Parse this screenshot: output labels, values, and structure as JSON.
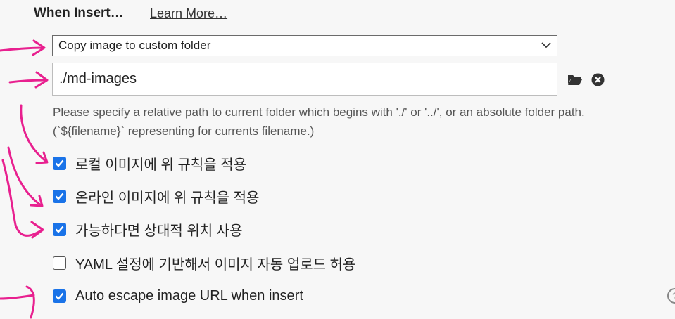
{
  "section": {
    "title": "When Insert…",
    "learn_more": "Learn More…"
  },
  "image_action_select": {
    "value": "Copy image to custom folder"
  },
  "path_input": {
    "value": "./md-images"
  },
  "hint": "Please specify a relative path to current folder which begins with './' or '../', or an absolute folder path. (`${filename}` representing for currents filename.)",
  "options": [
    {
      "label": "로컬 이미지에 위 규칙을 적용",
      "checked": true
    },
    {
      "label": "온라인 이미지에 위 규칙을 적용",
      "checked": true
    },
    {
      "label": "가능하다면 상대적 위치 사용",
      "checked": true
    },
    {
      "label": "YAML 설정에 기반해서 이미지 자동 업로드 허용",
      "checked": false
    },
    {
      "label": "Auto escape image URL when insert",
      "checked": true
    }
  ],
  "colors": {
    "checkbox_accent": "#1a73e8",
    "annotation": "#e8208f"
  },
  "icons": {
    "folder": "folder-icon",
    "clear": "close-circle-icon",
    "dropdown": "chevron-down-icon",
    "help": "help-icon"
  }
}
